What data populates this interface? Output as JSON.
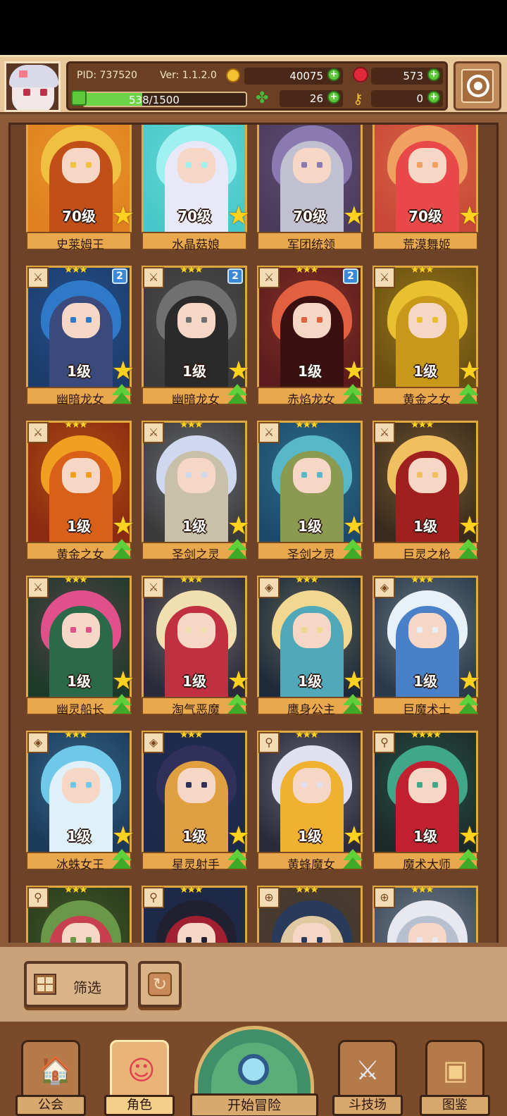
{
  "header": {
    "pid": "PID: 737520",
    "version": "Ver: 1.1.2.0",
    "gold": "40075",
    "gems": "573",
    "energy": "538/1500",
    "energy_fraction": 0.359,
    "clover": "26",
    "keys": "0",
    "plus": "+"
  },
  "cards": [
    {
      "level": "70级",
      "name": "史莱姆王",
      "palette": [
        "#e08020",
        "#f0c040",
        "#c05018"
      ]
    },
    {
      "level": "70级",
      "name": "水晶菇娘",
      "palette": [
        "#48c8c8",
        "#9ff0f0",
        "#e8e8f8"
      ]
    },
    {
      "level": "70级",
      "name": "军团统领",
      "palette": [
        "#4a3a5c",
        "#8a7ab0",
        "#c0c0d0"
      ]
    },
    {
      "level": "70级",
      "name": "荒漠舞姬",
      "palette": [
        "#c84838",
        "#f0a060",
        "#e84848"
      ]
    },
    {
      "level": "1级",
      "name": "幽暗龙女",
      "palette": [
        "#1c3c6c",
        "#2f7ac8",
        "#3b4a7c"
      ],
      "stars": "★★★",
      "type": "⚔",
      "badge": "2"
    },
    {
      "level": "1级",
      "name": "幽暗龙女",
      "palette": [
        "#3a3a3a",
        "#707070",
        "#2a2a2a"
      ],
      "stars": "★★★",
      "type": "⚔",
      "badge": "2"
    },
    {
      "level": "1级",
      "name": "赤焰龙女",
      "palette": [
        "#5a1c1c",
        "#e06040",
        "#3a1010"
      ],
      "stars": "★★★",
      "type": "⚔",
      "badge": "2"
    },
    {
      "level": "1级",
      "name": "黄金之女",
      "palette": [
        "#6a5010",
        "#e8c030",
        "#c89818"
      ],
      "stars": "★★★",
      "type": "⚔"
    },
    {
      "level": "1级",
      "name": "黄金之女",
      "palette": [
        "#8a2a10",
        "#f0a020",
        "#d86018"
      ],
      "stars": "★★★",
      "type": "⚔"
    },
    {
      "level": "1级",
      "name": "圣剑之灵",
      "palette": [
        "#3a3a3a",
        "#d0d8f0",
        "#c8c0a8"
      ],
      "stars": "★★★",
      "type": "⚔"
    },
    {
      "level": "1级",
      "name": "圣剑之灵",
      "palette": [
        "#1c4a6c",
        "#58b8c8",
        "#8a9a50"
      ],
      "stars": "★★★",
      "type": "⚔"
    },
    {
      "level": "1级",
      "name": "巨灵之枪",
      "palette": [
        "#3a2a1c",
        "#f0c060",
        "#a02020"
      ],
      "stars": "★★★",
      "type": "⚔"
    },
    {
      "level": "1级",
      "name": "幽灵船长",
      "palette": [
        "#1c3a2a",
        "#e0508a",
        "#2a6a4a"
      ],
      "stars": "★★★",
      "type": "⚔"
    },
    {
      "level": "1级",
      "name": "淘气恶魔",
      "palette": [
        "#2a2a3a",
        "#f0e0b0",
        "#c03040"
      ],
      "stars": "★★★",
      "type": "⚔"
    },
    {
      "level": "1级",
      "name": "鹰身公主",
      "palette": [
        "#1c2a3a",
        "#f0d890",
        "#50a8b8"
      ],
      "stars": "★★★",
      "type": "◈"
    },
    {
      "level": "1级",
      "name": "巨魔术士",
      "palette": [
        "#2a3a4a",
        "#e8f0f8",
        "#4a80c8"
      ],
      "stars": "★★★",
      "type": "◈"
    },
    {
      "level": "1级",
      "name": "冰蛛女王",
      "palette": [
        "#1c3a5a",
        "#70c8e8",
        "#e0f0f8"
      ],
      "stars": "★★★",
      "type": "◈"
    },
    {
      "level": "1级",
      "name": "星灵射手",
      "palette": [
        "#1c2a4a",
        "#30305a",
        "#e0a040"
      ],
      "stars": "★★★",
      "type": "◈"
    },
    {
      "level": "1级",
      "name": "黄蜂魔女",
      "palette": [
        "#2a2a3a",
        "#e0e0f0",
        "#f0b030"
      ],
      "stars": "★★★",
      "type": "⚲"
    },
    {
      "level": "1级",
      "name": "魔术大师",
      "palette": [
        "#1c2a2a",
        "#40a888",
        "#c02030"
      ],
      "stars": "★★★★",
      "type": "⚲"
    },
    {
      "level": "",
      "name": "",
      "palette": [
        "#2a3a1c",
        "#6a9848",
        "#c84050"
      ],
      "stars": "★★★",
      "type": "⚲"
    },
    {
      "level": "",
      "name": "",
      "palette": [
        "#1c2a4a",
        "#202030",
        "#a02030"
      ],
      "stars": "★★★",
      "type": "⚲"
    },
    {
      "level": "",
      "name": "",
      "palette": [
        "#4a3a2a",
        "#2a3a5a",
        "#e0c8a0"
      ],
      "stars": "★★★",
      "type": "⊕"
    },
    {
      "level": "",
      "name": "",
      "palette": [
        "#3a4a5a",
        "#e8e8f0",
        "#b8c0d0"
      ],
      "stars": "★★★",
      "type": "⊕"
    }
  ],
  "toolbar": {
    "filter_label": "筛选"
  },
  "nav": {
    "guild": "公会",
    "role": "角色",
    "adventure": "开始冒险",
    "arena": "斗技场",
    "codex": "图鉴"
  }
}
